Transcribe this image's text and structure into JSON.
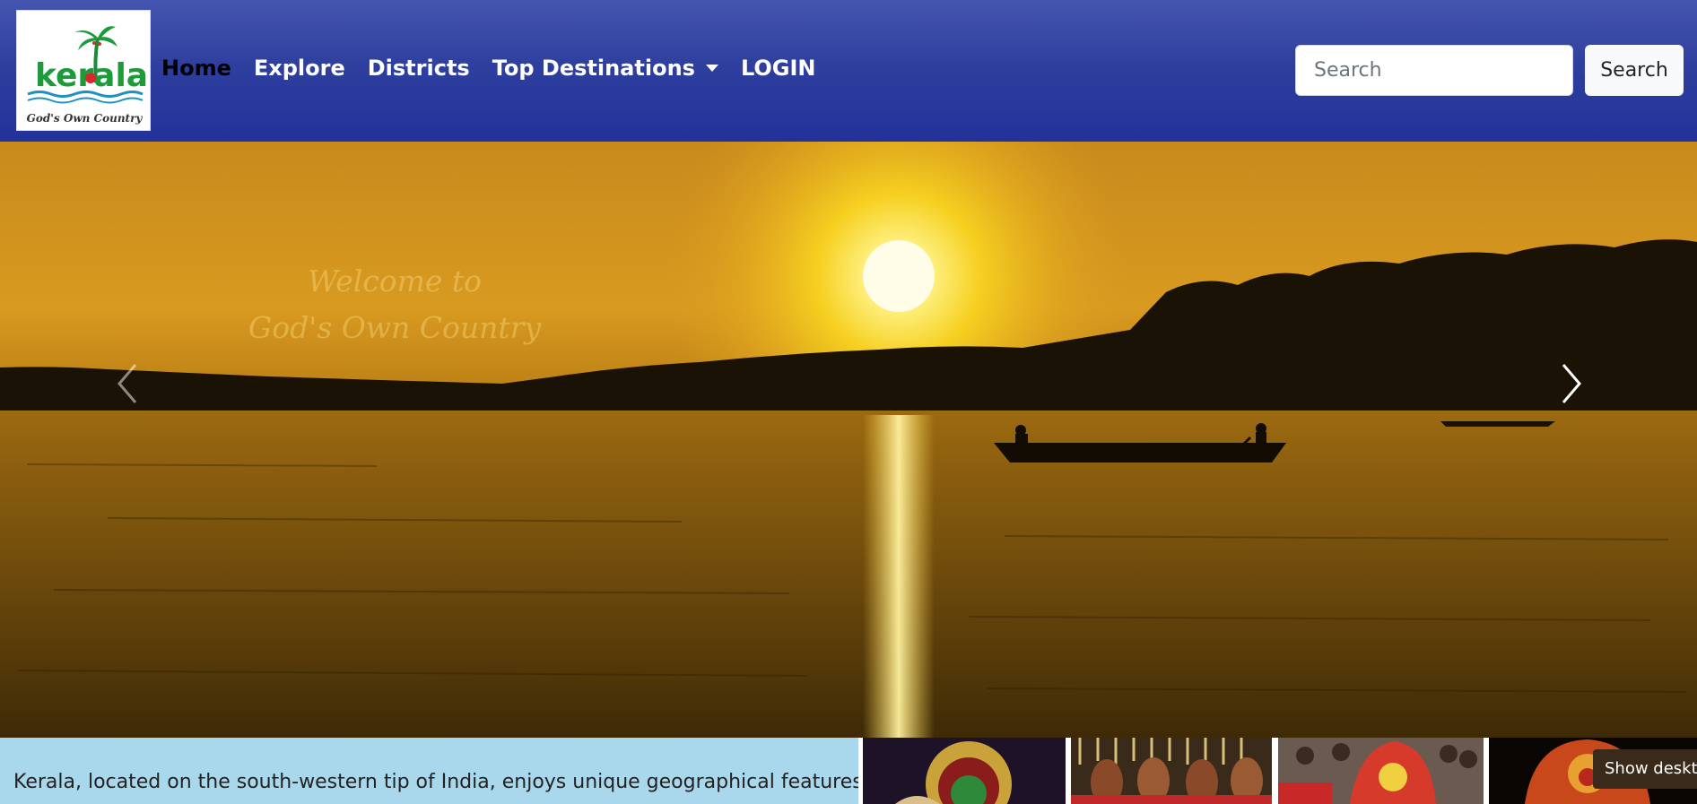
{
  "brand": {
    "logo_word": "kerala",
    "logo_tagline": "God's Own Country"
  },
  "nav": {
    "items": [
      {
        "label": "Home",
        "active": true
      },
      {
        "label": "Explore",
        "active": false
      },
      {
        "label": "Districts",
        "active": false
      },
      {
        "label": "Top Destinations",
        "active": false,
        "dropdown": true
      },
      {
        "label": "LOGIN",
        "active": false
      }
    ]
  },
  "search": {
    "placeholder": "Search",
    "value": "",
    "button_label": "Search"
  },
  "hero": {
    "welcome_line1": "Welcome to",
    "welcome_line2": "God's Own Country",
    "prev_icon": "chevron-left-icon",
    "next_icon": "chevron-right-icon"
  },
  "intro": {
    "text": "Kerala, located on the south-western tip of India, enjoys unique geographical features"
  },
  "toast": {
    "text": "Show deskto"
  },
  "colors": {
    "navbar": "#2f3f9e",
    "intro_bg": "#a9d8ec",
    "sunset": "#e0a020"
  }
}
